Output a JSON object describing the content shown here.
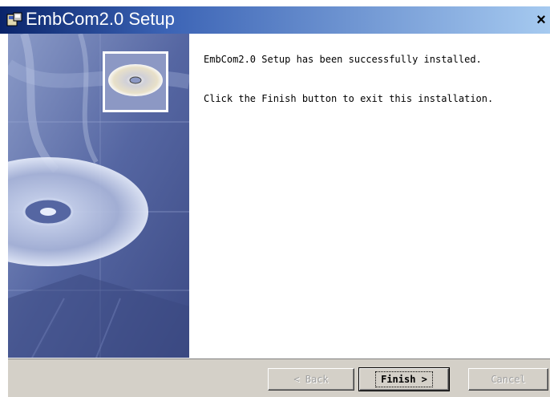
{
  "window": {
    "title": "EmbCom2.0 Setup",
    "close_label": "×"
  },
  "content": {
    "success_message": "EmbCom2.0 Setup has been successfully installed.",
    "instruction_message": "Click the Finish button to exit this installation."
  },
  "buttons": {
    "back_label": "< Back",
    "finish_label": "Finish >",
    "cancel_label": "Cancel",
    "back_enabled": false,
    "finish_enabled": true,
    "cancel_enabled": false
  },
  "colors": {
    "titlebar_start": "#0a246a",
    "titlebar_end": "#a6caf0",
    "button_face": "#d4d0c8",
    "disabled_text": "#a0a0a0"
  }
}
